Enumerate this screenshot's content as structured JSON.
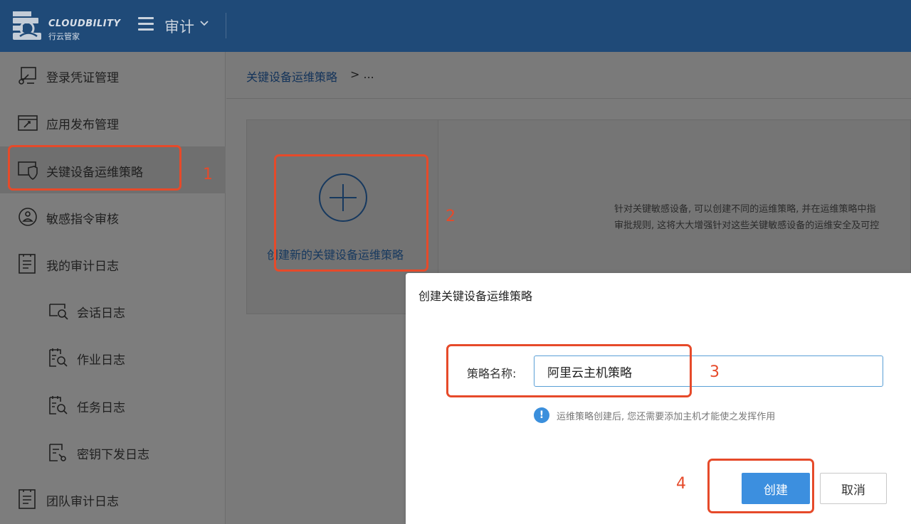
{
  "header": {
    "logo_en": "CLOUDBILITY",
    "logo_cn": "行云管家",
    "module_title": "审计",
    "colors": {
      "bar": "#1f4a78"
    }
  },
  "sidebar": {
    "items": [
      {
        "label": "登录凭证管理",
        "icon": "credential-icon"
      },
      {
        "label": "应用发布管理",
        "icon": "app-publish-icon"
      },
      {
        "label": "关键设备运维策略",
        "icon": "shield-screen-icon",
        "active": true
      },
      {
        "label": "敏感指令审核",
        "icon": "sensitive-command-icon"
      },
      {
        "label": "我的审计日志",
        "icon": "document-icon"
      },
      {
        "label": "会话日志",
        "icon": "session-log-icon"
      },
      {
        "label": "作业日志",
        "icon": "job-log-icon"
      },
      {
        "label": "任务日志",
        "icon": "task-log-icon"
      },
      {
        "label": "密钥下发日志",
        "icon": "key-log-icon"
      },
      {
        "label": "团队审计日志",
        "icon": "document-icon"
      }
    ]
  },
  "breadcrumb": {
    "link": "关键设备运维策略",
    "rest": "> ..."
  },
  "card": {
    "create_label": "创建新的关键设备运维策略",
    "description_line1": "针对关键敏感设备, 可以创建不同的运维策略, 并在运维策略中指",
    "description_line2": "审批规则, 这将大大增强针对这些关键敏感设备的运维安全及可控"
  },
  "dialog": {
    "title": "创建关键设备运维策略",
    "field_label": "策略名称:",
    "field_value": "阿里云主机策略",
    "hint": "运维策略创建后, 您还需要添加主机才能使之发挥作用",
    "create_button": "创建",
    "cancel_button": "取消"
  },
  "annotations": {
    "step1": "1",
    "step2": "2",
    "step3": "3",
    "step4": "4",
    "color": "#e64a2a"
  }
}
